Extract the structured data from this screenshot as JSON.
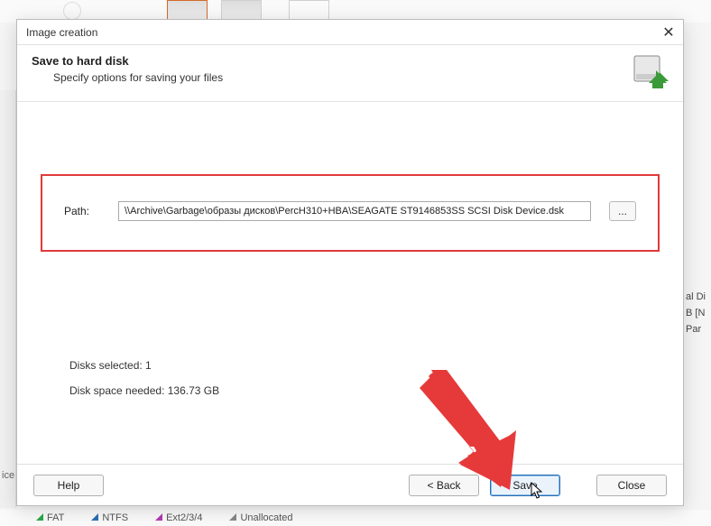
{
  "dialog": {
    "title": "Image creation",
    "header_title": "Save to hard disk",
    "header_sub": "Specify options for saving your files"
  },
  "path": {
    "label": "Path:",
    "value": "\\\\Archive\\Garbage\\образы дисков\\PercH310+HBA\\SEAGATE ST9146853SS SCSI Disk Device.dsk",
    "browse_label": "..."
  },
  "info": {
    "disks_selected_label": "Disks selected:",
    "disks_selected_count": "1",
    "space_needed_label": "Disk space needed:",
    "space_needed_value": "136.73 GB"
  },
  "buttons": {
    "help": "Help",
    "back": "< Back",
    "save": "Save",
    "close": "Close"
  },
  "bg_right": {
    "l1": "al Di",
    "l2": "B [N",
    "l3": "Par"
  },
  "bg_left_label": "ice",
  "legend": {
    "fat": {
      "label": "FAT",
      "color": "#2aa84a"
    },
    "ntfs": {
      "label": "NTFS",
      "color": "#2a6fb5"
    },
    "ext": {
      "label": "Ext2/3/4",
      "color": "#b03ab0"
    },
    "unall": {
      "label": "Unallocated",
      "color": "#888"
    }
  }
}
